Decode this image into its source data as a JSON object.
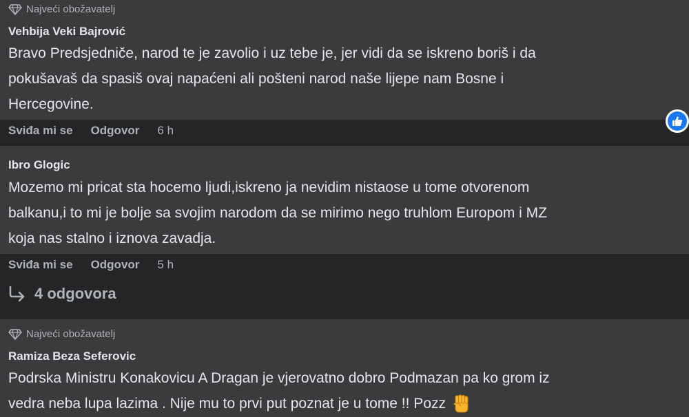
{
  "comments": [
    {
      "badge": "Najveći obožavatelj",
      "author": "Vehbija Veki Bajrović",
      "lines": [
        "Bravo Predsjedniče, narod te je zavolio i uz tebe je, jer vidi da se iskreno boriš i da",
        "pokušavaš da spasiš ovaj napaćeni ali pošteni narod naše lijepe nam Bosne i",
        "Hercegovine."
      ],
      "like_label": "Sviđa mi se",
      "reply_label": "Odgovor",
      "time": "6 h",
      "reaction_icon": "like-icon",
      "reaction_color": "#1877f2"
    },
    {
      "author": "Ibro Glogic",
      "lines": [
        "Mozemo mi pricat sta hocemo ljudi,iskreno ja nevidim nistaose u tome otvorenom",
        "balkanu,i to mi je bolje sa svojim narodom da se mirimo nego truhlom Europom i MZ",
        "koja nas stalno i iznova zavadja."
      ],
      "like_label": "Sviđa mi se",
      "reply_label": "Odgovor",
      "time": "5 h",
      "replies_label": "4 odgovora"
    },
    {
      "badge": "Najveći obožavatelj",
      "author": "Ramiza Beza Seferovic",
      "lines": [
        "Podrska Ministru Konakovicu A Dragan je vjerovatno dobro Podmazan pa ko grom iz",
        "vedra neba lupa lazima . Nije mu to prvi put poznat je u tome !! Pozz"
      ],
      "emoji": "raised-fist-icon"
    }
  ],
  "colors": {
    "background": "#242526",
    "bubble": "#3a3b3c",
    "text": "#e4e6eb",
    "secondary_text": "#b0b3b8",
    "like_blue": "#1877f2"
  }
}
